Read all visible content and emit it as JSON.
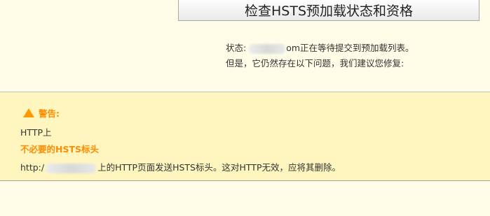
{
  "check_button": {
    "label": "检查HSTS预加载状态和资格"
  },
  "status": {
    "prefix": "状态:",
    "domain_suffix": "om",
    "message": "正在等待提交到预加载列表。",
    "line2": "但是，它仍然存在以下问题，我们建议您修复:"
  },
  "warning": {
    "title": "警告:",
    "section": "HTTP上",
    "issue_title": "不必要的HSTS标头",
    "desc_prefix": "http:/",
    "desc_text": "上的HTTP页面发送HSTS标头。这对HTTP无效，应将其删除。"
  },
  "colors": {
    "background": "#fffde7",
    "warning_background": "#fff6bf",
    "warning_accent": "#ff8c00"
  },
  "icons": {
    "warning": "warning-triangle-icon"
  }
}
